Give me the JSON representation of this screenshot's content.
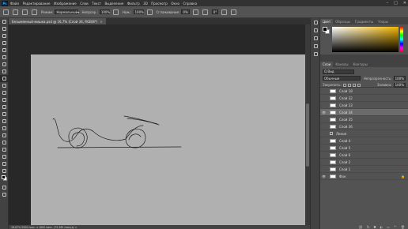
{
  "app": {
    "logo": "Ps"
  },
  "menubar": {
    "items": [
      "Файл",
      "Редактирование",
      "Изображение",
      "Слои",
      "Текст",
      "Выделение",
      "Фильтр",
      "3D",
      "Просмотр",
      "Окно",
      "Справка"
    ]
  },
  "window_controls": {
    "minimize": "–",
    "maximize": "□",
    "close": "✕"
  },
  "options": {
    "mode_label": "Режим:",
    "mode_value": "Нормальный",
    "opacity_label": "Непрозр.:",
    "opacity_value": "100%",
    "flow_label": "Наж.:",
    "flow_value": "100%",
    "smoothing_label": "Сглаживание:",
    "smoothing_value": "0%",
    "angle_value": "0°"
  },
  "document": {
    "tab_title": "Безымянный-мишкa.psd @ 16,7% (Слой 34, RGB/8*)",
    "tab_close": "×"
  },
  "statusbar": {
    "text": "16,67%    3000 пикс. x 1800 пикс. (72,285 пикс/д)  >"
  },
  "color_panel": {
    "tabs": [
      "Цвет",
      "Образцы",
      "Градиенты",
      "Узоры"
    ]
  },
  "layers_panel": {
    "tabs": [
      "Слои",
      "Каналы",
      "Контуры"
    ],
    "filter_label": "Q Вид",
    "blend_mode": "Обычные",
    "opacity_label": "Непрозрачность:",
    "opacity_value": "100%",
    "lock_label": "Закрепить:",
    "fill_label": "Заливка:",
    "fill_value": "100%"
  },
  "layers": [
    {
      "name": "Слой 18"
    },
    {
      "name": "Слой 32"
    },
    {
      "name": "Слой 33"
    },
    {
      "name": "Слой 34"
    },
    {
      "name": "Слой 35"
    },
    {
      "name": "Слой 36"
    },
    {
      "name": "Линия"
    },
    {
      "name": "Слой 4"
    },
    {
      "name": "Слой 5"
    },
    {
      "name": "Слой 6"
    },
    {
      "name": "Слой 2"
    },
    {
      "name": "Слой 1"
    },
    {
      "name": "Фон"
    }
  ],
  "footer_icons": [
    "link-icon",
    "fx-icon",
    "mask-icon",
    "adjustment-icon",
    "group-icon",
    "new-layer-icon",
    "delete-icon"
  ]
}
